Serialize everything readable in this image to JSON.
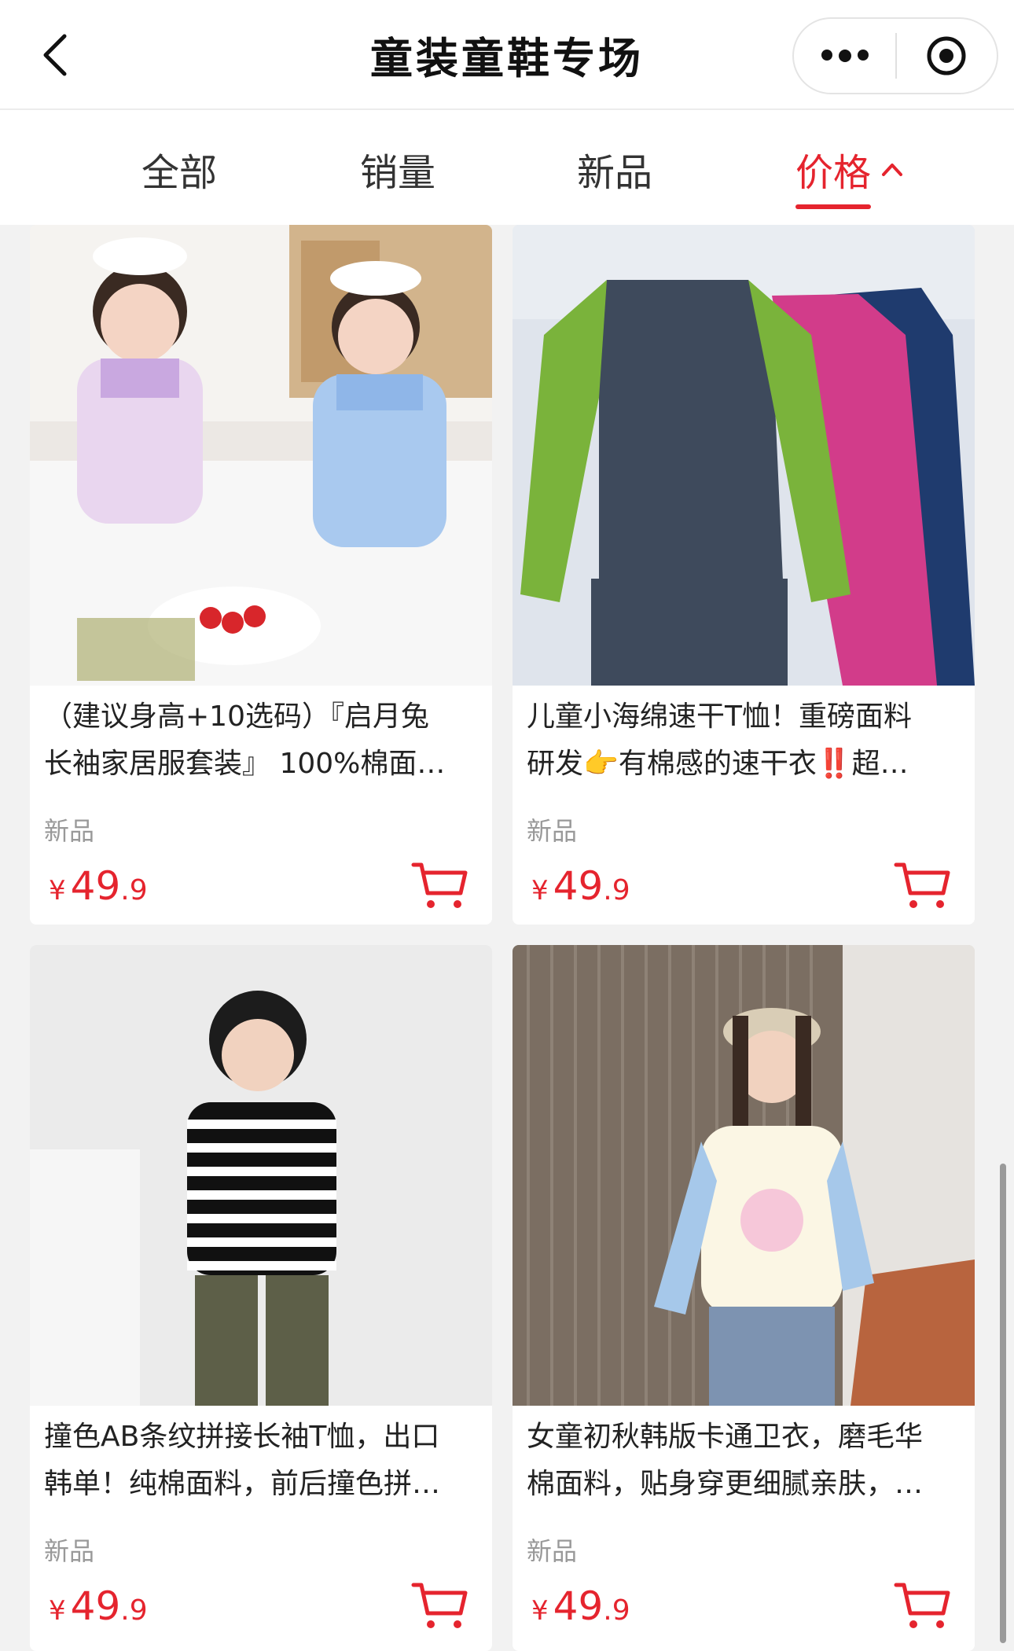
{
  "header": {
    "title": "童装童鞋专场"
  },
  "tabs": [
    {
      "label": "全部",
      "active": false
    },
    {
      "label": "销量",
      "active": false
    },
    {
      "label": "新品",
      "active": false
    },
    {
      "label": "价格",
      "active": true,
      "icon": "chevron-up-icon"
    }
  ],
  "accent_color": "#e5242e",
  "products": [
    {
      "title_line1": "（建议身高+10选码）『启月兔",
      "title_line2": "长袖家居服套装』 100%棉面…",
      "tag": "新品",
      "price_symbol": "¥",
      "price_int": "49",
      "price_dec": ".9"
    },
    {
      "title_line1": "儿童小海绵速干T恤！重磅面料",
      "title_line2": "研发👉有棉感的速干衣‼️超…",
      "tag": "新品",
      "price_symbol": "¥",
      "price_int": "49",
      "price_dec": ".9"
    },
    {
      "title_line1": "撞色AB条纹拼接长袖T恤，出口",
      "title_line2": "韩单！纯棉面料，前后撞色拼…",
      "tag": "新品",
      "price_symbol": "¥",
      "price_int": "49",
      "price_dec": ".9"
    },
    {
      "title_line1": "女童初秋韩版卡通卫衣，磨毛华",
      "title_line2": "棉面料，贴身穿更细腻亲肤，…",
      "tag": "新品",
      "price_symbol": "¥",
      "price_int": "49",
      "price_dec": ".9"
    }
  ]
}
